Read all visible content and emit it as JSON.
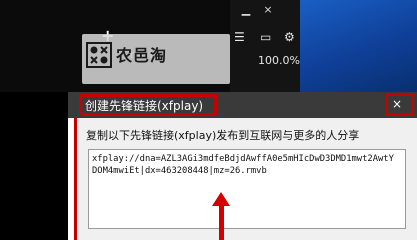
{
  "watermark": {
    "text": "农邑淘"
  },
  "player": {
    "percent": "100.0%",
    "file_fragment": "rmvb",
    "buttons": {
      "minimize": "▁",
      "close": "×"
    }
  },
  "dialog": {
    "title": "创建先锋链接(xfplay)",
    "instruction": "复制以下先锋链接(xfplay)发布到互联网与更多的人分享",
    "link": "xfplay://dna=AZL3AGi3mdfeBdjdAwffA0e5mHIcDwD3DMD1mwt2AwtYDOM4mwiEt|dx=463208448|mz=26.rmvb",
    "close_label": "×"
  },
  "colors": {
    "highlight": "#c80000",
    "arrow": "#d40000",
    "desktop_blue": "#1a5fc4"
  }
}
